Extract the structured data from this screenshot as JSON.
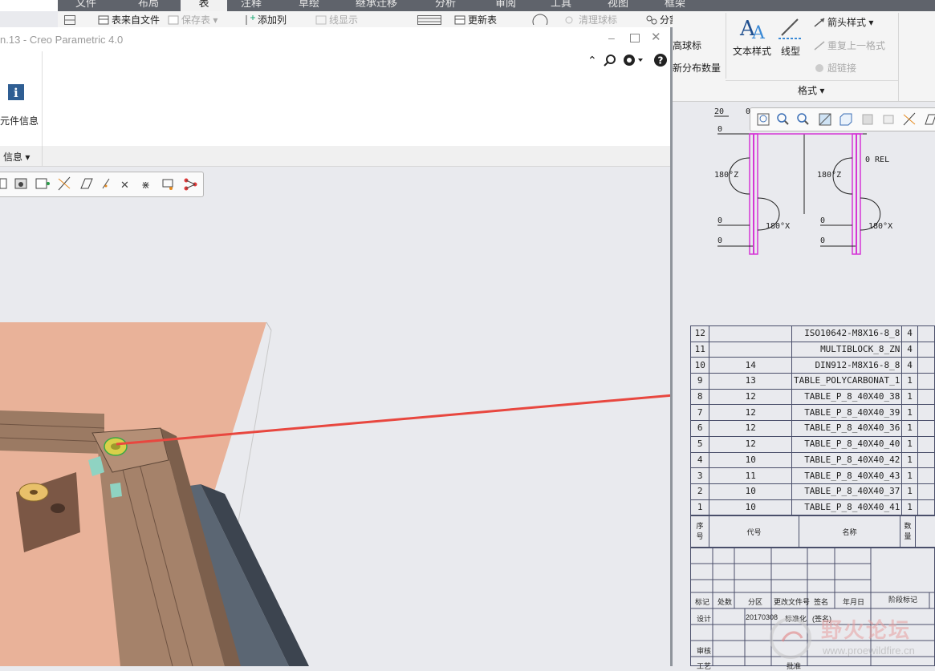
{
  "ribbon_tabs": [
    "文件",
    "布局",
    "表",
    "注释",
    "草绘",
    "继承迁移",
    "分析",
    "审阅",
    "工具",
    "视图",
    "框架"
  ],
  "bg_ribbon": {
    "from_file": "表来自文件",
    "save_table": "保存表",
    "add_column": "添加列",
    "line_display": "线显示",
    "update_table": "更新表",
    "clean_balloons": "清理球标",
    "split_balloons": "分割球标",
    "balloons": "高球标",
    "redistribute_qty": "新分布数量"
  },
  "format_group": {
    "text_style": "文本样式",
    "line_style": "线型",
    "arrow_style": "箭头样式",
    "repeat_last_format": "重复上一格式",
    "hyperlink": "超链接",
    "group_label": "格式"
  },
  "creo": {
    "title": "n.13 - Creo Parametric 4.0",
    "component_info": "元件信息",
    "info_group": "信息"
  },
  "drawing": {
    "dims": {
      "a": "20",
      "b": "0",
      "c": "0",
      "d": "180°Z",
      "e": "180°Z",
      "f": "0 REL",
      "g": "0",
      "h": "0",
      "i": "180°X",
      "j": "180°X",
      "k": "0",
      "l": "0"
    },
    "bom_rows": [
      {
        "no": "12",
        "code": "",
        "name": "ISO10642-M8X16-8_8",
        "qty": "4"
      },
      {
        "no": "11",
        "code": "",
        "name": "MULTIBLOCK_8_ZN",
        "qty": "4"
      },
      {
        "no": "10",
        "code": "14",
        "name": "DIN912-M8X16-8_8",
        "qty": "4"
      },
      {
        "no": "9",
        "code": "13",
        "name": "TABLE_POLYCARBONAT_1",
        "qty": "1"
      },
      {
        "no": "8",
        "code": "12",
        "name": "TABLE_P_8_40X40_38",
        "qty": "1"
      },
      {
        "no": "7",
        "code": "12",
        "name": "TABLE_P_8_40X40_39",
        "qty": "1"
      },
      {
        "no": "6",
        "code": "12",
        "name": "TABLE_P_8_40X40_36",
        "qty": "1"
      },
      {
        "no": "5",
        "code": "12",
        "name": "TABLE_P_8_40X40_40",
        "qty": "1"
      },
      {
        "no": "4",
        "code": "10",
        "name": "TABLE_P_8_40X40_42",
        "qty": "1"
      },
      {
        "no": "3",
        "code": "11",
        "name": "TABLE_P_8_40X40_43",
        "qty": "1"
      },
      {
        "no": "2",
        "code": "10",
        "name": "TABLE_P_8_40X40_37",
        "qty": "1"
      },
      {
        "no": "1",
        "code": "10",
        "name": "TABLE_P_8_40X40_41",
        "qty": "1"
      }
    ],
    "bom_header": {
      "no": "序号",
      "code": "代号",
      "name": "名称",
      "qty": "数量"
    },
    "title_block": {
      "mark": "标记",
      "count": "处数",
      "zone": "分区",
      "change_doc": "更改文件号",
      "sign": "签名",
      "date": "年月日",
      "stage_mark": "阶段标记",
      "design": "设计",
      "design_date": "20170308",
      "standardize": "标准化",
      "signature": "(签名)",
      "review": "审核",
      "process": "工艺",
      "approve": "批准"
    }
  },
  "watermark": {
    "cn": "野火论坛",
    "url": "www.proewildfire.cn"
  },
  "colors": {
    "accent_red": "#e8473f",
    "bom_line": "#4a4f6a",
    "plate": "#e9a88a",
    "profile": "#9b7a63"
  }
}
